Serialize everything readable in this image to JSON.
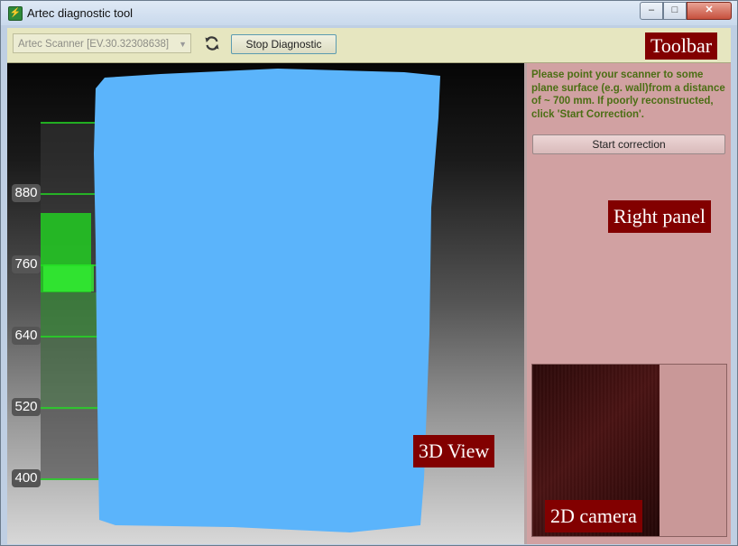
{
  "window": {
    "title": "Artec diagnostic tool"
  },
  "titlebar": {
    "min_glyph": "–",
    "max_glyph": "□",
    "close_glyph": "✕"
  },
  "toolbar": {
    "scanner_select_value": "Artec Scanner [EV.30.32308638]",
    "stop_button_label": "Stop Diagnostic",
    "annotation": "Toolbar"
  },
  "view3d": {
    "annotation": "3D View",
    "depth_scale": {
      "ticks": [
        "880",
        "760",
        "640",
        "520",
        "400"
      ],
      "tick_values": [
        880,
        760,
        640,
        520,
        400
      ],
      "range_mm": [
        400,
        1000
      ],
      "highlight_range_mm": [
        710,
        850
      ],
      "colors": {
        "scale_bg": "#3a3a3a",
        "gridline": "#22dd22",
        "highlight": "#22cc22"
      }
    },
    "surface_color": "#5bb4fb"
  },
  "right_panel": {
    "hint_text": "Please point your scanner to some plane surface (e.g. wall)from a distance of ~ 700 mm. If poorly reconstructed, click 'Start Correction'.",
    "start_correction_label": "Start correction",
    "annotation": "Right panel",
    "camera_annotation": "2D camera"
  },
  "colors": {
    "annotation_bg": "#820000",
    "toolbar_bg": "#e6e6c0",
    "right_panel_bg": "#d1a1a2",
    "hint_text": "#4b6e14"
  },
  "icons": {
    "app": "app-icon",
    "refresh": "refresh-icon",
    "dropdown": "chevron-down-icon"
  }
}
